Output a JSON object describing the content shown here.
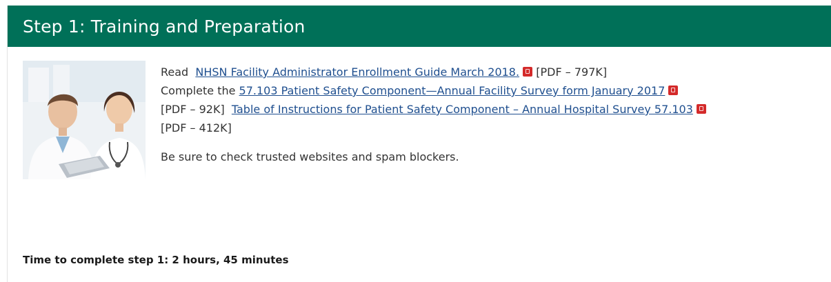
{
  "step": {
    "title": "Step 1: Training and Preparation"
  },
  "instructions": {
    "read_prefix": "Read",
    "guide_link": "NHSN Facility Administrator Enrollment Guide March 2018.",
    "guide_size": "[PDF – 797K]",
    "complete_prefix": "Complete the",
    "survey_link": "57.103 Patient Safety Component—Annual Facility Survey form January 2017",
    "survey_size": "[PDF – 92K]",
    "table_link": "Table of Instructions for Patient Safety Component – Annual Hospital Survey 57.103",
    "table_size": "[PDF – 412K]",
    "note": "Be sure to check trusted websites and spam blockers."
  },
  "time_to_complete": "Time to complete step 1: 2 hours, 45 minutes",
  "icons": {
    "pdf": "pdf-icon"
  },
  "colors": {
    "header_bg": "#007058",
    "link": "#1f4f8f",
    "pdf_icon": "#d42a2a"
  }
}
